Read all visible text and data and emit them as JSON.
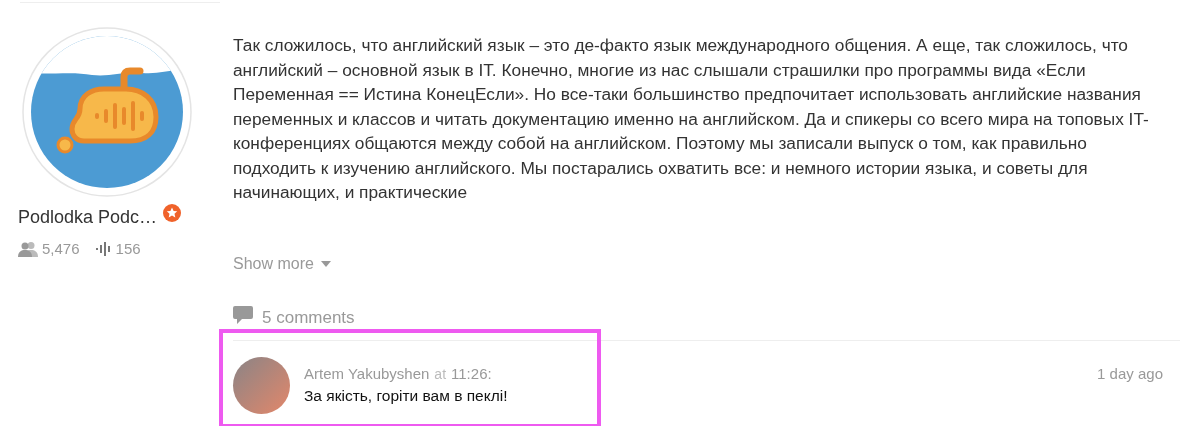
{
  "podcast": {
    "name": "Podlodka Podc…",
    "verified": true,
    "followers": "5,476",
    "episodes": "156"
  },
  "description": {
    "text": "Так сложилось, что английский язык – это де-факто язык международного общения. А еще, так сложилось, что английский – основной язык в IT. Конечно, многие из нас слышали страшилки про программы вида «Если Переменная == Истина КонецЕсли». Но все-таки большинство предпочитает использовать английские названия переменных и классов и читать документацию именно на английском. Да и спикеры со всего мира на топовых IT-конференциях общаются между собой на английском. Поэтому мы записали выпуск о том, как правильно подходить к изучению английского. Мы постарались охватить все: и немного истории языка, и советы для начинающих, и практические",
    "show_more": "Show more"
  },
  "comments": {
    "count": "5 comments",
    "items": [
      {
        "author": "Artem Yakubyshen",
        "at": "at",
        "time": "11:26:",
        "text": "За якість, горіти вам в пеклі!",
        "age": "1 day ago"
      }
    ]
  }
}
